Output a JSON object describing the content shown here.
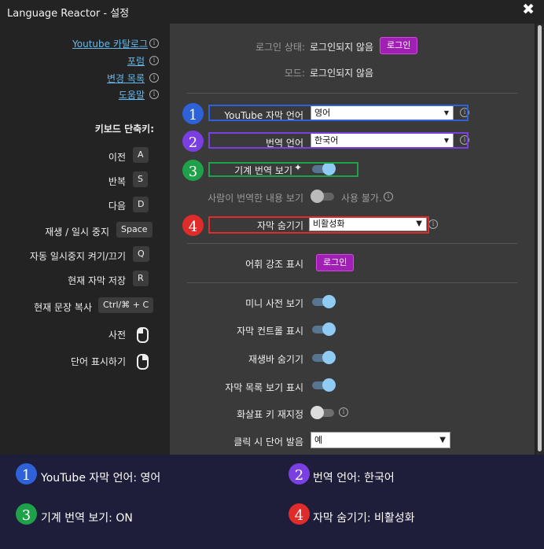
{
  "window": {
    "title": "Language Reactor - 설정",
    "close": "✖"
  },
  "left": {
    "links": [
      "Youtube 카탈로그",
      "포럼",
      "변경 목록",
      "도움말"
    ],
    "shortcuts_title": "키보드 단축키:",
    "shortcuts": [
      {
        "label": "이전",
        "key": "A"
      },
      {
        "label": "반복",
        "key": "S"
      },
      {
        "label": "다음",
        "key": "D"
      },
      {
        "label": "재생 / 일시 중지",
        "key": "Space"
      },
      {
        "label": "자동 일시중지 켜기/끄기",
        "key": "Q"
      },
      {
        "label": "현재 자막 저장",
        "key": "R"
      },
      {
        "label": "현재 문장 복사",
        "key": "Ctrl/⌘ + C"
      }
    ],
    "mouse_rows": [
      {
        "label": "사전"
      },
      {
        "label": "단어 표시하기"
      }
    ]
  },
  "right": {
    "login_status_label": "로그인 상태:",
    "login_status_value": "로그인되지 않음",
    "login_button": "로그인",
    "mode_label": "모드:",
    "mode_value": "로그인되지 않음",
    "subtitle_lang_label": "YouTube 자막 언어",
    "subtitle_lang_value": "영어",
    "translation_lang_label": "번역 언어",
    "translation_lang_value": "한국어",
    "machine_translation_label": "기계 번역 보기",
    "human_translation_label": "사람이 번역한 내용 보기",
    "human_translation_unavailable": "사용 불가.",
    "hide_subs_label": "자막 숨기기",
    "hide_subs_value": "비활성화",
    "vocab_label": "어휘 강조 표시",
    "vocab_button": "로그인",
    "mini_dict_label": "미니 사전 보기",
    "sub_controls_label": "자막 컨트롤 표시",
    "hide_playbar_label": "재생바 숨기기",
    "sub_list_label": "자막 목록 보기 표시",
    "arrow_remap_label": "화살표 키 재지정",
    "click_pron_label": "클릭 시 단어 발음",
    "click_pron_value": "예"
  },
  "annotations": [
    {
      "num": "1",
      "text": "YouTube 자막 언어: 영어",
      "color": "#2f62d8"
    },
    {
      "num": "2",
      "text": "번역 언어: 한국어",
      "color": "#7a3fe0"
    },
    {
      "num": "3",
      "text": "기계 번역 보기: ON",
      "color": "#1fa14a"
    },
    {
      "num": "4",
      "text": "자막 숨기기: 비활성화",
      "color": "#e02b2b"
    }
  ]
}
